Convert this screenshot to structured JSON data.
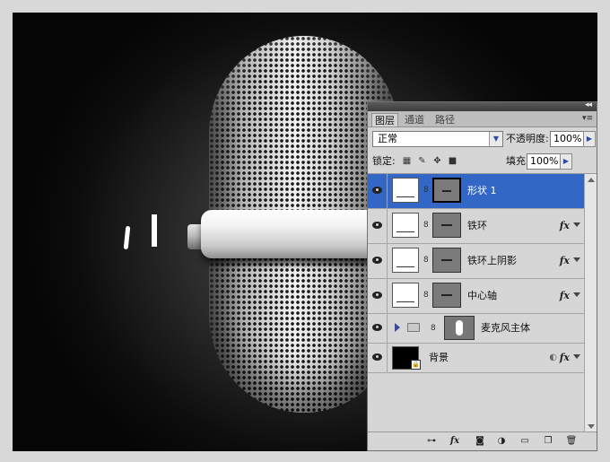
{
  "panel": {
    "tabs": [
      "图层",
      "通道",
      "路径"
    ],
    "active_tab": 0,
    "blend_mode": "正常",
    "opacity_label": "不透明度:",
    "opacity_value": "100%",
    "lock_label": "锁定:",
    "fill_label": "填充:",
    "fill_value": "100%",
    "menu_icon": "panel-menu-icon",
    "collapse_icon": "collapse-double-arrow-icon"
  },
  "layers": [
    {
      "name": "形状 1",
      "selected": true,
      "fx": false
    },
    {
      "name": "铁环",
      "selected": false,
      "fx": true
    },
    {
      "name": "铁环上阴影",
      "selected": false,
      "fx": true
    },
    {
      "name": "中心轴",
      "selected": false,
      "fx": true
    },
    {
      "name": "麦克风主体",
      "type": "group",
      "fx": false
    },
    {
      "name": "背景",
      "type": "background",
      "fx": true
    }
  ],
  "fx_label": "fx",
  "footer_icons": [
    "link-layers-icon",
    "add-style-icon",
    "add-mask-icon",
    "adjustment-layer-icon",
    "new-group-icon",
    "new-layer-icon",
    "delete-layer-icon"
  ],
  "colors": {
    "selection": "#3267c6",
    "panel_bg": "#d6d6d6",
    "canvas_bg": "#000000"
  }
}
